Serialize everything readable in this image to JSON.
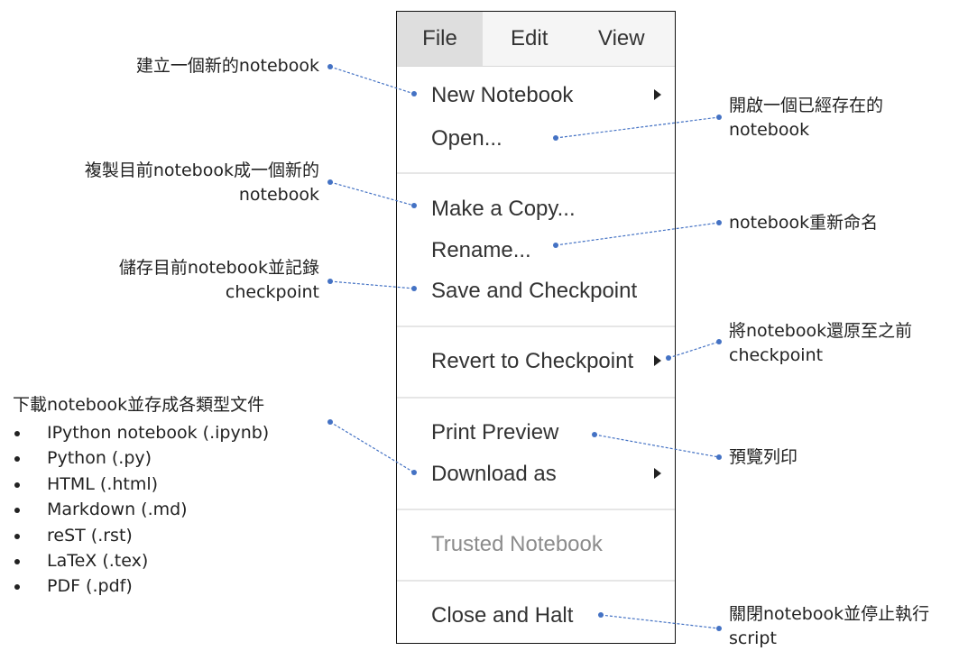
{
  "menubar": {
    "file": "File",
    "edit": "Edit",
    "view": "View"
  },
  "menu": {
    "new_notebook": "New Notebook",
    "open": "Open...",
    "make_copy": "Make a Copy...",
    "rename": "Rename...",
    "save_checkpoint": "Save and Checkpoint",
    "revert": "Revert to Checkpoint",
    "print_preview": "Print Preview",
    "download_as": "Download as",
    "trusted": "Trusted Notebook",
    "close_halt": "Close and Halt"
  },
  "annotations": {
    "new_notebook": "建立一個新的notebook",
    "open": [
      "開啟一個已經存在的",
      "notebook"
    ],
    "make_copy": [
      "複製目前notebook成一個新的",
      "notebook"
    ],
    "rename": "notebook重新命名",
    "save": [
      "儲存目前notebook並記錄",
      "checkpoint"
    ],
    "revert": [
      "將notebook還原至之前",
      "checkpoint"
    ],
    "download": {
      "title": "下載notebook並存成各類型文件",
      "formats": [
        "IPython notebook (.ipynb)",
        "Python (.py)",
        "HTML (.html)",
        "Markdown (.md)",
        "reST (.rst)",
        "LaTeX (.tex)",
        "PDF (.pdf)"
      ]
    },
    "print": "預覽列印",
    "close": [
      "關閉notebook並停止執行",
      "script"
    ]
  },
  "colors": {
    "connector": "#4472c4",
    "disabled_text": "#8c8c8c",
    "active_tab_bg": "#dedede"
  }
}
